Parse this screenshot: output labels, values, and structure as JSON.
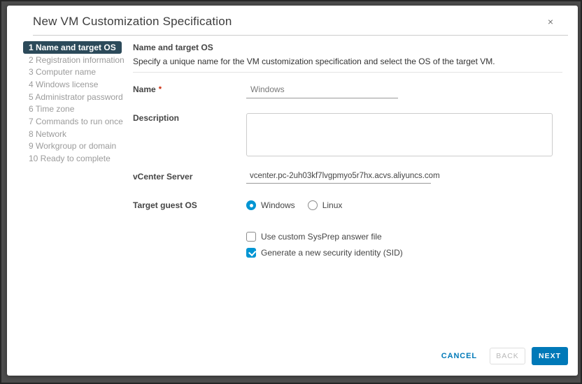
{
  "dialog": {
    "title": "New VM Customization Specification",
    "close_label": "×"
  },
  "steps": {
    "items": [
      {
        "label": "1 Name and target OS",
        "active": true
      },
      {
        "label": "2 Registration information",
        "active": false
      },
      {
        "label": "3 Computer name",
        "active": false
      },
      {
        "label": "4 Windows license",
        "active": false
      },
      {
        "label": "5 Administrator password",
        "active": false
      },
      {
        "label": "6 Time zone",
        "active": false
      },
      {
        "label": "7 Commands to run once",
        "active": false
      },
      {
        "label": "8 Network",
        "active": false
      },
      {
        "label": "9 Workgroup or domain",
        "active": false
      },
      {
        "label": "10 Ready to complete",
        "active": false
      }
    ]
  },
  "content": {
    "heading": "Name and target OS",
    "subtitle": "Specify a unique name for the VM customization specification and select the OS of the target VM.",
    "name_field": {
      "label": "Name",
      "required_marker": "*",
      "value": "Windows"
    },
    "description_field": {
      "label": "Description",
      "value": ""
    },
    "vcenter_field": {
      "label": "vCenter Server",
      "value": "vcenter.pc-2uh03kf7lvgpmyo5r7hx.acvs.aliyuncs.com"
    },
    "target_os": {
      "label": "Target guest OS",
      "options": [
        {
          "label": "Windows",
          "selected": true
        },
        {
          "label": "Linux",
          "selected": false
        }
      ]
    },
    "checkboxes": [
      {
        "label": "Use custom SysPrep answer file",
        "checked": false
      },
      {
        "label": "Generate a new security identity (SID)",
        "checked": true
      }
    ]
  },
  "footer": {
    "cancel_label": "CANCEL",
    "back_label": "BACK",
    "next_label": "NEXT"
  },
  "colors": {
    "accent_blue": "#0095d3",
    "button_blue": "#0079b8",
    "active_step_bg": "#2c4a5a",
    "required_red": "#c92100",
    "backdrop": "#4c4c4c"
  }
}
